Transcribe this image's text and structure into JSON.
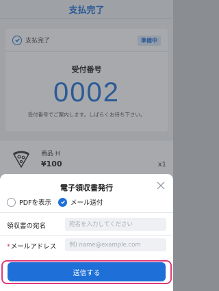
{
  "header": {
    "title": "支払完了"
  },
  "status_card": {
    "status_text": "支払完了",
    "badge": "準備中",
    "receipt_label": "受付番号",
    "receipt_number": "0002",
    "note": "受付番号でご案内します。しばらくお待ち下さい。"
  },
  "order_item": {
    "icon": "pizza-icon",
    "name": "商品 H",
    "price": "¥100",
    "quantity": "x1"
  },
  "modal": {
    "title": "電子領収書発行",
    "close_icon": "close-icon",
    "options": [
      {
        "label": "PDFを表示",
        "selected": false
      },
      {
        "label": "メール送付",
        "selected": true
      }
    ],
    "fields": {
      "name_label": "領収書の宛名",
      "name_placeholder": "宛名を入力してください",
      "name_value": "",
      "email_required_mark": "*",
      "email_label": "メールアドレス",
      "email_placeholder": "例) name@example.com",
      "email_value": ""
    },
    "submit_label": "送信する"
  },
  "colors": {
    "accent": "#1f6fd8",
    "highlight_border": "#e0397a",
    "required": "#d9365a"
  }
}
